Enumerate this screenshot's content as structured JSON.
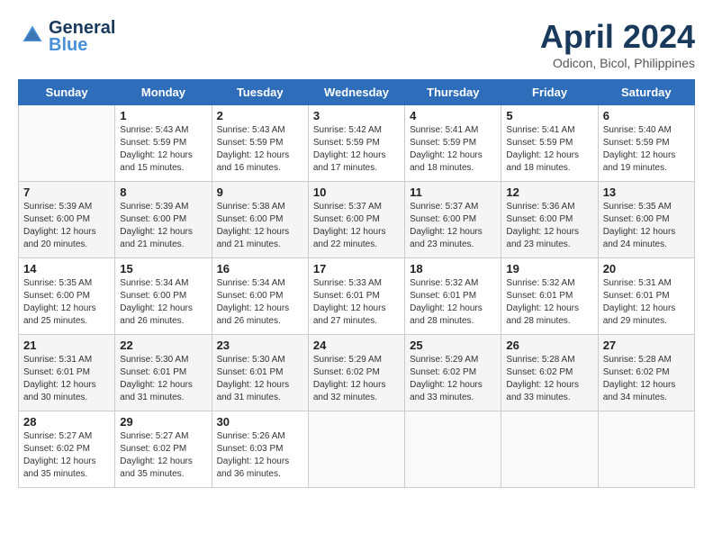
{
  "header": {
    "logo_line1": "General",
    "logo_line2": "Blue",
    "month": "April 2024",
    "location": "Odicon, Bicol, Philippines"
  },
  "days_of_week": [
    "Sunday",
    "Monday",
    "Tuesday",
    "Wednesday",
    "Thursday",
    "Friday",
    "Saturday"
  ],
  "weeks": [
    [
      {
        "day": "",
        "empty": true
      },
      {
        "day": "1",
        "sunrise": "5:43 AM",
        "sunset": "5:59 PM",
        "daylight": "12 hours and 15 minutes."
      },
      {
        "day": "2",
        "sunrise": "5:43 AM",
        "sunset": "5:59 PM",
        "daylight": "12 hours and 16 minutes."
      },
      {
        "day": "3",
        "sunrise": "5:42 AM",
        "sunset": "5:59 PM",
        "daylight": "12 hours and 17 minutes."
      },
      {
        "day": "4",
        "sunrise": "5:41 AM",
        "sunset": "5:59 PM",
        "daylight": "12 hours and 18 minutes."
      },
      {
        "day": "5",
        "sunrise": "5:41 AM",
        "sunset": "5:59 PM",
        "daylight": "12 hours and 18 minutes."
      },
      {
        "day": "6",
        "sunrise": "5:40 AM",
        "sunset": "5:59 PM",
        "daylight": "12 hours and 19 minutes."
      }
    ],
    [
      {
        "day": "7",
        "sunrise": "5:39 AM",
        "sunset": "6:00 PM",
        "daylight": "12 hours and 20 minutes."
      },
      {
        "day": "8",
        "sunrise": "5:39 AM",
        "sunset": "6:00 PM",
        "daylight": "12 hours and 21 minutes."
      },
      {
        "day": "9",
        "sunrise": "5:38 AM",
        "sunset": "6:00 PM",
        "daylight": "12 hours and 21 minutes."
      },
      {
        "day": "10",
        "sunrise": "5:37 AM",
        "sunset": "6:00 PM",
        "daylight": "12 hours and 22 minutes."
      },
      {
        "day": "11",
        "sunrise": "5:37 AM",
        "sunset": "6:00 PM",
        "daylight": "12 hours and 23 minutes."
      },
      {
        "day": "12",
        "sunrise": "5:36 AM",
        "sunset": "6:00 PM",
        "daylight": "12 hours and 23 minutes."
      },
      {
        "day": "13",
        "sunrise": "5:35 AM",
        "sunset": "6:00 PM",
        "daylight": "12 hours and 24 minutes."
      }
    ],
    [
      {
        "day": "14",
        "sunrise": "5:35 AM",
        "sunset": "6:00 PM",
        "daylight": "12 hours and 25 minutes."
      },
      {
        "day": "15",
        "sunrise": "5:34 AM",
        "sunset": "6:00 PM",
        "daylight": "12 hours and 26 minutes."
      },
      {
        "day": "16",
        "sunrise": "5:34 AM",
        "sunset": "6:00 PM",
        "daylight": "12 hours and 26 minutes."
      },
      {
        "day": "17",
        "sunrise": "5:33 AM",
        "sunset": "6:01 PM",
        "daylight": "12 hours and 27 minutes."
      },
      {
        "day": "18",
        "sunrise": "5:32 AM",
        "sunset": "6:01 PM",
        "daylight": "12 hours and 28 minutes."
      },
      {
        "day": "19",
        "sunrise": "5:32 AM",
        "sunset": "6:01 PM",
        "daylight": "12 hours and 28 minutes."
      },
      {
        "day": "20",
        "sunrise": "5:31 AM",
        "sunset": "6:01 PM",
        "daylight": "12 hours and 29 minutes."
      }
    ],
    [
      {
        "day": "21",
        "sunrise": "5:31 AM",
        "sunset": "6:01 PM",
        "daylight": "12 hours and 30 minutes."
      },
      {
        "day": "22",
        "sunrise": "5:30 AM",
        "sunset": "6:01 PM",
        "daylight": "12 hours and 31 minutes."
      },
      {
        "day": "23",
        "sunrise": "5:30 AM",
        "sunset": "6:01 PM",
        "daylight": "12 hours and 31 minutes."
      },
      {
        "day": "24",
        "sunrise": "5:29 AM",
        "sunset": "6:02 PM",
        "daylight": "12 hours and 32 minutes."
      },
      {
        "day": "25",
        "sunrise": "5:29 AM",
        "sunset": "6:02 PM",
        "daylight": "12 hours and 33 minutes."
      },
      {
        "day": "26",
        "sunrise": "5:28 AM",
        "sunset": "6:02 PM",
        "daylight": "12 hours and 33 minutes."
      },
      {
        "day": "27",
        "sunrise": "5:28 AM",
        "sunset": "6:02 PM",
        "daylight": "12 hours and 34 minutes."
      }
    ],
    [
      {
        "day": "28",
        "sunrise": "5:27 AM",
        "sunset": "6:02 PM",
        "daylight": "12 hours and 35 minutes."
      },
      {
        "day": "29",
        "sunrise": "5:27 AM",
        "sunset": "6:02 PM",
        "daylight": "12 hours and 35 minutes."
      },
      {
        "day": "30",
        "sunrise": "5:26 AM",
        "sunset": "6:03 PM",
        "daylight": "12 hours and 36 minutes."
      },
      {
        "day": "",
        "empty": true
      },
      {
        "day": "",
        "empty": true
      },
      {
        "day": "",
        "empty": true
      },
      {
        "day": "",
        "empty": true
      }
    ]
  ]
}
